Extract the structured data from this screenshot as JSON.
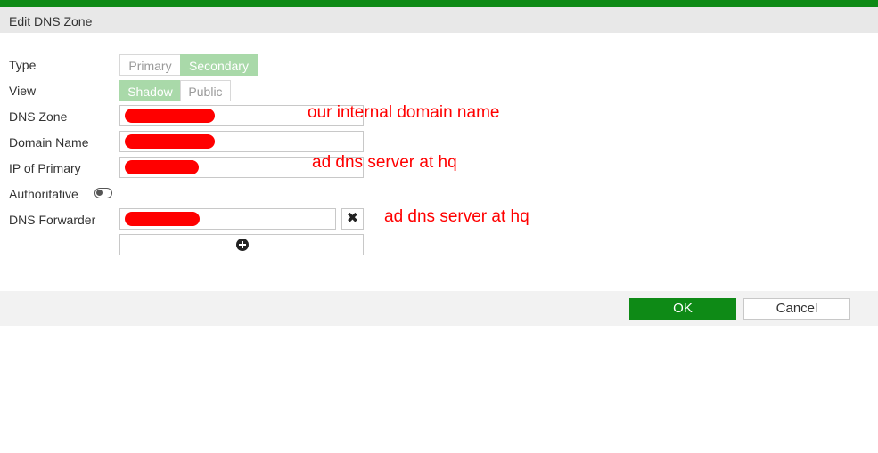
{
  "dialog": {
    "title": "Edit DNS Zone"
  },
  "fields": {
    "type": {
      "label": "Type",
      "options": [
        "Primary",
        "Secondary"
      ],
      "selected": "Secondary"
    },
    "view": {
      "label": "View",
      "options": [
        "Shadow",
        "Public"
      ],
      "selected": "Shadow"
    },
    "dns_zone": {
      "label": "DNS Zone"
    },
    "domain_name": {
      "label": "Domain Name"
    },
    "ip_of_primary": {
      "label": "IP of Primary"
    },
    "authoritative": {
      "label": "Authoritative",
      "enabled": false
    },
    "dns_forwarder": {
      "label": "DNS Forwarder"
    }
  },
  "annotations": {
    "dns_zone": "our internal domain name",
    "ip_of_primary": "ad dns server at hq",
    "dns_forwarder": "ad dns server at hq"
  },
  "buttons": {
    "ok": "OK",
    "cancel": "Cancel"
  },
  "icons": {
    "remove": "close-icon",
    "add": "plus-circle-icon",
    "toggle": "toggle-off-icon"
  },
  "colors": {
    "accent": "#0e8a16",
    "selected_segment": "#a9d9a9",
    "redaction": "#ff0000"
  }
}
